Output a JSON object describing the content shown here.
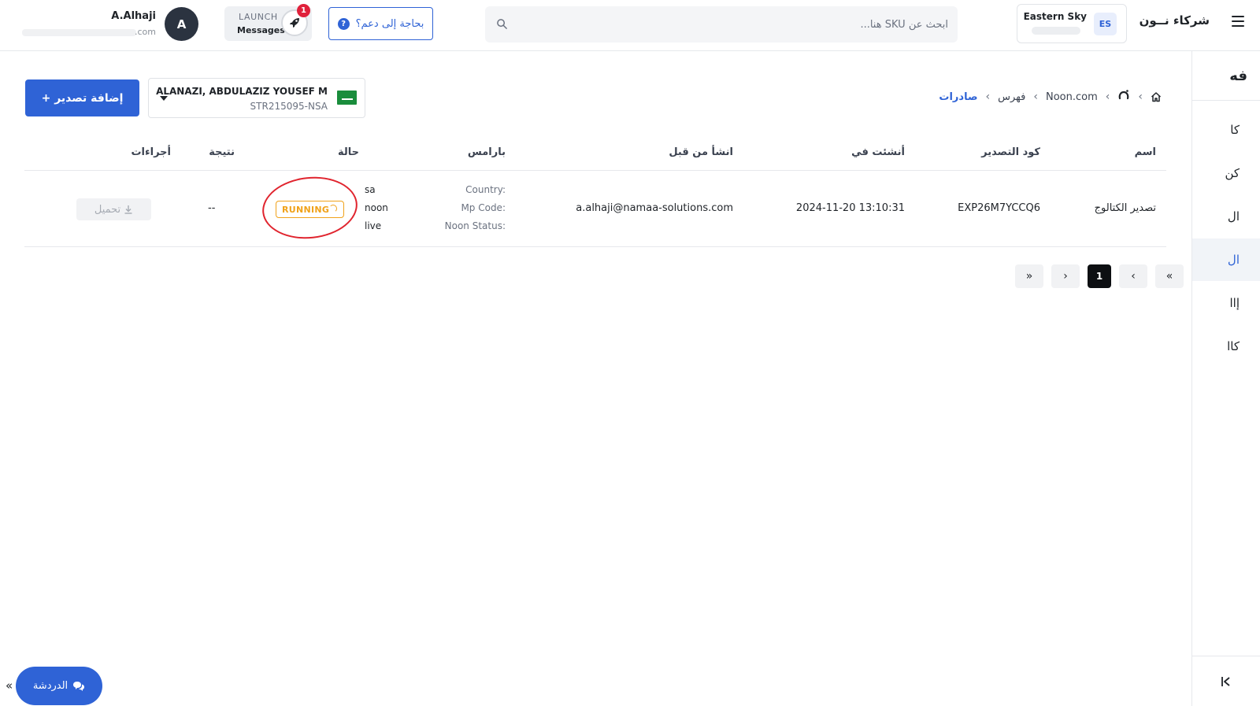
{
  "header": {
    "brand": "شركاء نــون",
    "store": {
      "badge": "ES",
      "name": "Eastern Sky"
    },
    "search": {
      "placeholder": "ابحث عن SKU هنا..."
    },
    "help_label": "بحاجة إلى دعم؟",
    "help_icon": "?",
    "launch": {
      "title": "LAUNCH",
      "subtitle": "Messages",
      "count": "1"
    },
    "user": {
      "initial": "A",
      "name": "A.Alhaji",
      "email_tail": ".com"
    }
  },
  "sidebar": {
    "header": "فه",
    "items": [
      {
        "label": "كا"
      },
      {
        "label": "كن"
      },
      {
        "label": "ال"
      },
      {
        "label": "ال",
        "active": true
      },
      {
        "label": "إاا"
      },
      {
        "label": "كاا"
      }
    ]
  },
  "breadcrumb": {
    "items": [
      "Noon.com",
      "فهرس",
      "صادرات"
    ]
  },
  "seller": {
    "name": "ALANAZI, ABDULAZIZ YOUSEF M",
    "id": "STR215095-NSA"
  },
  "add_export_label": "+ إضافة تصدير",
  "table": {
    "columns": {
      "name": "اسم",
      "export_code": "كود التصدير",
      "created_at": "أنشئت في",
      "created_by": "انشأ من قبل",
      "params": "بارامس",
      "status": "حالة",
      "result": "نتيجة",
      "actions": "أجراءات"
    },
    "rows": [
      {
        "name": "تصدير الكتالوج",
        "export_code": "EXP26M7YCCQ6",
        "created_at": "2024-11-20 13:10:31",
        "created_by": "a.alhaji@namaa-solutions.com",
        "params": [
          {
            "key": "Country:",
            "value": "sa"
          },
          {
            "key": "Mp Code:",
            "value": "noon"
          },
          {
            "key": "Noon Status:",
            "value": "live"
          }
        ],
        "status": "RUNNING",
        "result": "--",
        "action": "تحميل"
      }
    ]
  },
  "pagination": {
    "current": "1",
    "first": "«",
    "prev": "‹",
    "next": "›",
    "last": "»"
  },
  "chat": {
    "label": "الدردشة",
    "collapse": "«"
  },
  "colors": {
    "primary": "#2f63d6",
    "running": "#f0a21a",
    "annotation": "#e0242e"
  }
}
